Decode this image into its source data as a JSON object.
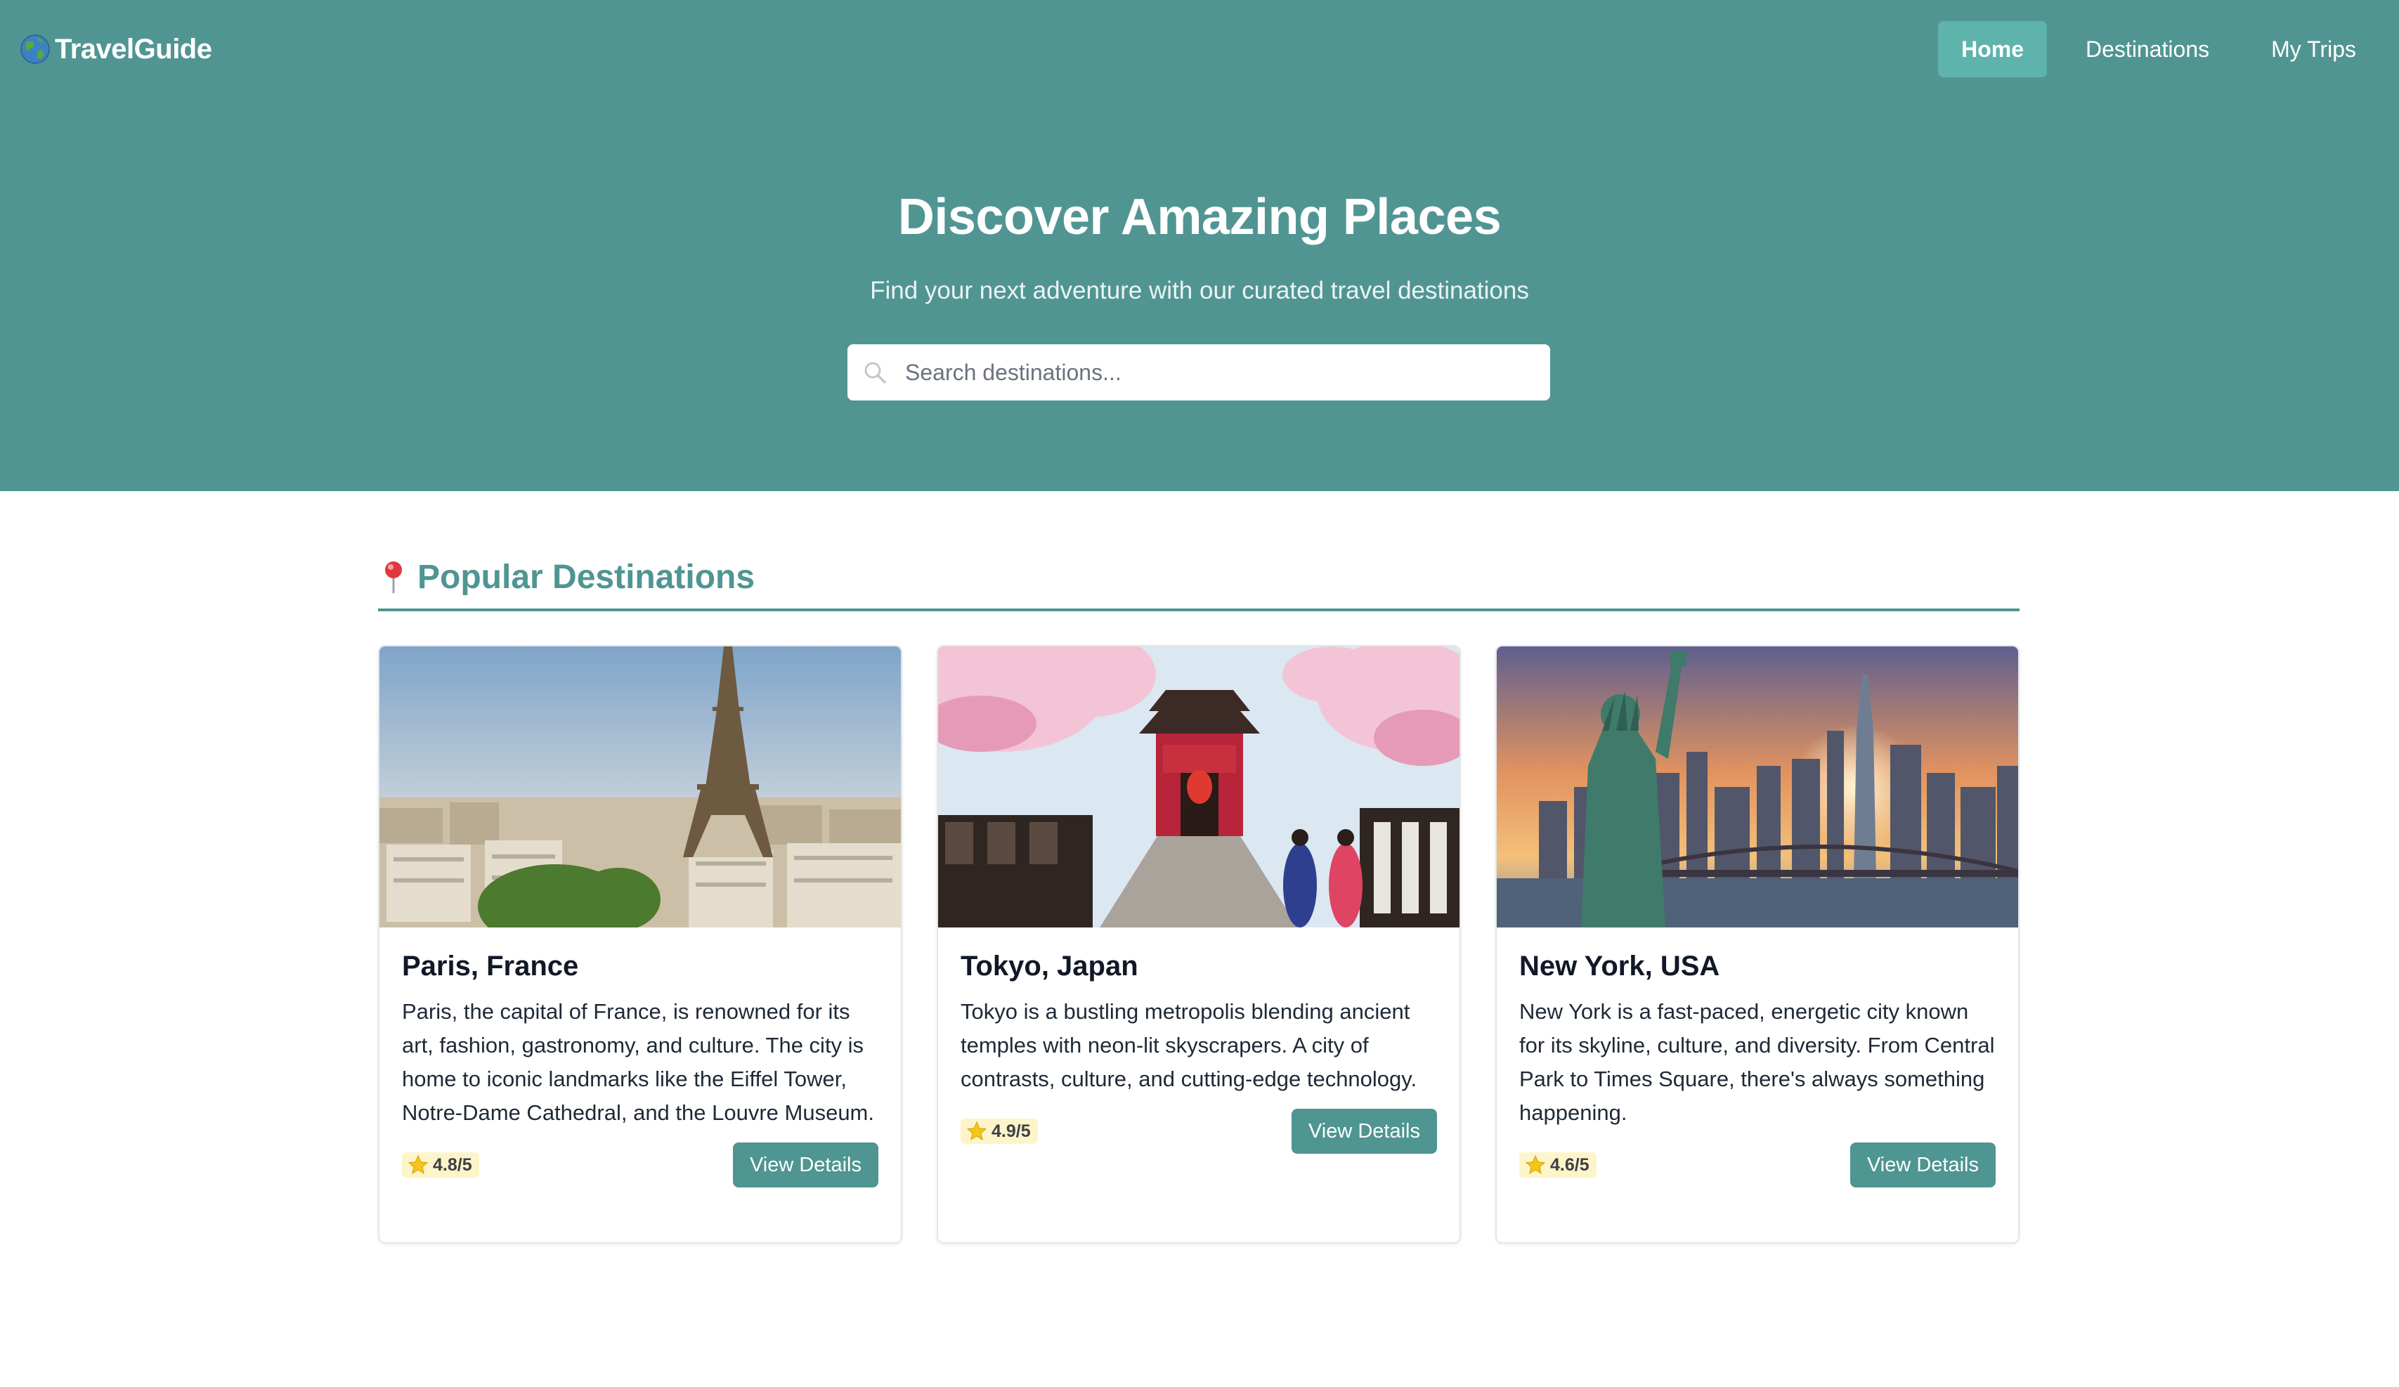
{
  "header": {
    "brand_name": "TravelGuide",
    "brand_icon": "globe-icon",
    "nav": [
      {
        "label": "Home",
        "active": true
      },
      {
        "label": "Destinations",
        "active": false
      },
      {
        "label": "My Trips",
        "active": false
      }
    ]
  },
  "hero": {
    "title": "Discover Amazing Places",
    "subtitle": "Find your next adventure with our curated travel destinations",
    "search": {
      "placeholder": "Search destinations...",
      "value": "",
      "icon": "search-icon"
    }
  },
  "section": {
    "icon": "pin-icon",
    "title": "Popular Destinations"
  },
  "destinations": [
    {
      "title": "Paris, France",
      "description": "Paris, the capital of France, is renowned for its art, fashion, gastronomy, and culture. The city is home to iconic landmarks like the Eiffel Tower, Notre-Dame Cathedral, and the Louvre Museum.",
      "rating": "4.8/5",
      "button": "View Details",
      "image": "eiffel-tower-cityscape-photo"
    },
    {
      "title": "Tokyo, Japan",
      "description": "Tokyo is a bustling metropolis blending ancient temples with neon-lit skyscrapers. A city of contrasts, culture, and cutting-edge technology.",
      "rating": "4.9/5",
      "button": "View Details",
      "image": "temple-cherry-blossom-photo"
    },
    {
      "title": "New York, USA",
      "description": "New York is a fast-paced, energetic city known for its skyline, culture, and diversity. From Central Park to Times Square, there's always something happening.",
      "rating": "4.6/5",
      "button": "View Details",
      "image": "statue-of-liberty-skyline-photo"
    }
  ],
  "colors": {
    "primary": "#519593",
    "nav_active": "#5fb3ad",
    "rating_bg": "#fdf5c9",
    "text": "#1f2937"
  }
}
